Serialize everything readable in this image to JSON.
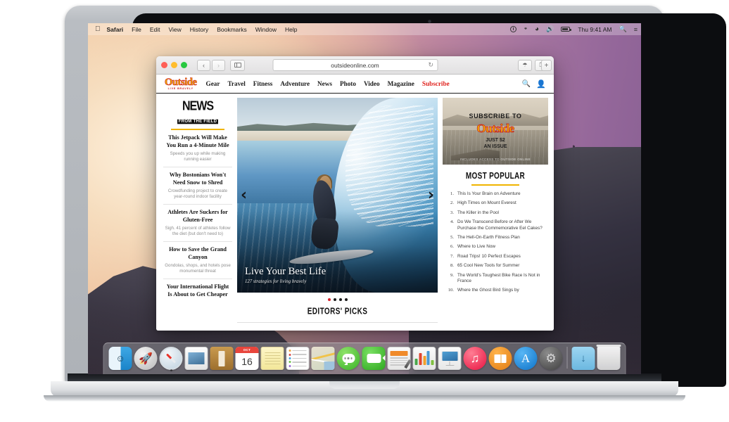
{
  "menubar": {
    "apple": "apple-logo",
    "items": [
      {
        "label": "Safari",
        "bold": true
      },
      {
        "label": "File",
        "bold": false
      },
      {
        "label": "Edit",
        "bold": false
      },
      {
        "label": "View",
        "bold": false
      },
      {
        "label": "History",
        "bold": false
      },
      {
        "label": "Bookmarks",
        "bold": false
      },
      {
        "label": "Window",
        "bold": false
      },
      {
        "label": "Help",
        "bold": false
      }
    ],
    "status_icons": [
      "time-machine-icon",
      "bluetooth-icon",
      "wifi-icon",
      "volume-icon",
      "battery-icon"
    ],
    "clock": "Thu 9:41 AM",
    "search_icon": "spotlight-search-icon",
    "notification_icon": "notification-center-icon"
  },
  "safari": {
    "traffic_lights": [
      "close",
      "minimize",
      "zoom"
    ],
    "back_label": "‹",
    "forward_label": "›",
    "sidebar_icon": "sidebar-icon",
    "url": "outsideonline.com",
    "reload_label": "↻",
    "share_icon": "share-icon",
    "tabs_icon": "show-tabs-icon",
    "new_tab_label": "+"
  },
  "site": {
    "logo": {
      "word": "Outside",
      "tagline": "LIVE BRAVELY"
    },
    "nav": [
      {
        "label": "Gear",
        "accent": false
      },
      {
        "label": "Travel",
        "accent": false
      },
      {
        "label": "Fitness",
        "accent": false
      },
      {
        "label": "Adventure",
        "accent": false
      },
      {
        "label": "News",
        "accent": false
      },
      {
        "label": "Photo",
        "accent": false
      },
      {
        "label": "Video",
        "accent": false
      },
      {
        "label": "Magazine",
        "accent": false
      },
      {
        "label": "Subscribe",
        "accent": true
      }
    ],
    "nav_icons": {
      "search": "search-icon",
      "account": "user-account-icon"
    },
    "news_from_field": {
      "line1": "NEWS",
      "line2": "FROM THE FIELD",
      "articles": [
        {
          "title": "This Jetpack Will Make You Run a 4-Minute Mile",
          "dek": "Speeds you up while making running easier"
        },
        {
          "title": "Why Bostonians Won't Need Snow to Shred",
          "dek": "Crowdfunding project to create year-round indoor facility"
        },
        {
          "title": "Athletes Are Suckers for Gluten-Free",
          "dek": "Sigh. 41 percent of athletes follow the diet (but don't need to)"
        },
        {
          "title": "How to Save the Grand Canyon",
          "dek": "Gondolas, shops, and hotels pose monumental threat"
        },
        {
          "title": "Your International Flight Is About to Get Cheaper",
          "dek": ""
        }
      ]
    },
    "hero": {
      "title": "Live Your Best Life",
      "subtitle": "127 strategies for living bravely",
      "prev_label": "‹",
      "next_label": "›",
      "dots": 4,
      "active_dot": 0,
      "active_dot_color": "#d8202a"
    },
    "editors_picks": "EDITORS' PICKS",
    "subscribe_ad": {
      "heading": "SUBSCRIBE TO",
      "brand": "Outside",
      "price_line1": "JUST $2",
      "price_line2": "AN ISSUE",
      "fine_print": "INCLUDES ACCESS TO OUTSIDE ONLINE"
    },
    "most_popular": {
      "title": "MOST POPULAR",
      "items": [
        {
          "n": "1.",
          "title": "This Is Your Brain on Adventure"
        },
        {
          "n": "2.",
          "title": "High Times on Mount Everest"
        },
        {
          "n": "3.",
          "title": "The Killer in the Pool"
        },
        {
          "n": "4.",
          "title": "Do We Transcend Before or After We Purchase the Commemorative Eel Cakes?"
        },
        {
          "n": "5.",
          "title": "The Hell-On-Earth Fitness Plan"
        },
        {
          "n": "6.",
          "title": "Where to Live Now"
        },
        {
          "n": "7.",
          "title": "Road Trips! 10 Perfect Escapes"
        },
        {
          "n": "8.",
          "title": "65 Cool New Tools for Summer"
        },
        {
          "n": "9.",
          "title": "The World's Toughest Bike Race Is Not in France"
        },
        {
          "n": "10.",
          "title": "Where the Ghost Bird Sings by"
        }
      ]
    }
  },
  "dock": {
    "calendar": {
      "month": "OCT",
      "day": "16"
    },
    "items": [
      {
        "name": "finder",
        "label": "Finder",
        "running": true
      },
      {
        "name": "launchpad",
        "label": "Launchpad",
        "running": false
      },
      {
        "name": "safari",
        "label": "Safari",
        "running": true
      },
      {
        "name": "photos",
        "label": "Photos",
        "running": false
      },
      {
        "name": "contacts",
        "label": "Contacts",
        "running": false
      },
      {
        "name": "calendar",
        "label": "Calendar",
        "running": false
      },
      {
        "name": "notes",
        "label": "Notes",
        "running": false
      },
      {
        "name": "reminders",
        "label": "Reminders",
        "running": false
      },
      {
        "name": "maps",
        "label": "Maps",
        "running": false
      },
      {
        "name": "messages",
        "label": "Messages",
        "running": false
      },
      {
        "name": "facetime",
        "label": "FaceTime",
        "running": false
      },
      {
        "name": "pages",
        "label": "Pages",
        "running": false
      },
      {
        "name": "numbers",
        "label": "Numbers",
        "running": false
      },
      {
        "name": "keynote",
        "label": "Keynote",
        "running": false
      },
      {
        "name": "itunes",
        "label": "iTunes",
        "running": false
      },
      {
        "name": "ibooks",
        "label": "iBooks",
        "running": false
      },
      {
        "name": "appstore",
        "label": "App Store",
        "running": false
      },
      {
        "name": "systempreferences",
        "label": "System Preferences",
        "running": false
      },
      {
        "name": "downloads",
        "label": "Downloads",
        "running": false
      },
      {
        "name": "trash",
        "label": "Trash",
        "running": false
      }
    ]
  },
  "colors": {
    "brand_yellow": "#f0b400",
    "brand_red": "#c9141b",
    "subscribe_red": "#e0241f",
    "accent_dot": "#d8202a"
  }
}
